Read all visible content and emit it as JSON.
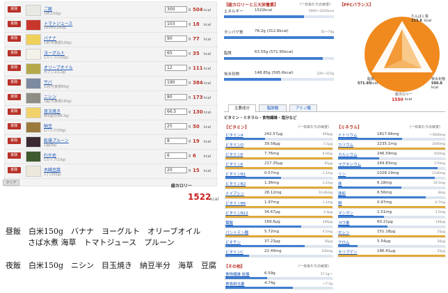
{
  "food_list": {
    "delete_label": "削除",
    "items": [
      {
        "name": "ご飯",
        "sub": "1杯(150g)",
        "qty": "300",
        "unit": "g",
        "kcal": "504",
        "thumb_color": "#e9e9e4"
      },
      {
        "name": "トマトジュース",
        "sub": "180ml(180g)",
        "qty": "103",
        "unit": "g",
        "kcal": "18",
        "thumb_color": "#c9372c"
      },
      {
        "name": "バナナ",
        "sub": "1本(可食部100g)",
        "qty": "90",
        "unit": "g",
        "kcal": "77",
        "thumb_color": "#efd05a"
      },
      {
        "name": "ヨーグルト",
        "sub": "1カップ(100g)",
        "qty": "65",
        "unit": "g",
        "kcal": "35",
        "thumb_color": "#f4f1e8"
      },
      {
        "name": "オリーブオイル",
        "sub": "大さじ1(12g)",
        "qty": "12",
        "unit": "g",
        "kcal": "111",
        "thumb_color": "#b4a94a"
      },
      {
        "name": "サバ",
        "sub": "1切(可食部80g)",
        "qty": "190",
        "unit": "g",
        "kcal": "384",
        "thumb_color": "#7d8aa0"
      },
      {
        "name": "ニシン",
        "sub": "1尾(可食部160g)",
        "qty": "80",
        "unit": "g",
        "kcal": "173",
        "thumb_color": "#8e8e86"
      },
      {
        "name": "目玉焼き",
        "sub": "卵1個分(66.5g)",
        "qty": "66.5",
        "unit": "g",
        "kcal": "130",
        "thumb_color": "#f2d36b"
      },
      {
        "name": "納豆",
        "sub": "1パック(50g)",
        "qty": "25",
        "unit": "g",
        "kcal": "50",
        "thumb_color": "#9c7a3e"
      },
      {
        "name": "乾燥プルーン",
        "sub": "1個(8g)",
        "qty": "8",
        "unit": "g",
        "kcal": "19",
        "thumb_color": "#3b2a33"
      },
      {
        "name": "わかめ",
        "sub": "1カップ(10g)",
        "qty": "6",
        "unit": "g",
        "kcal": "6",
        "thumb_color": "#3e5a2e"
      },
      {
        "name": "木綿豆腐",
        "sub": "1丁(300g)",
        "qty": "20",
        "unit": "g",
        "kcal": "15",
        "thumb_color": "#ece8dc"
      }
    ],
    "kcal_unit": "kcal",
    "clear_label": "クリア",
    "total_label": "総カロリー",
    "total_value": "1522",
    "total_unit": "kcal"
  },
  "memo": {
    "line1": "昼飯　白米150g　バナナ　ヨーグルト　オリーブオイル",
    "line2": "さば水煮 海草　トマトジュース　プルーン",
    "line3": "夜飯　白米150g　ニシン　目玉焼き　納豆半分　海草　豆腐"
  },
  "summary": {
    "title": "【総カロリーと三大栄養素】",
    "target_label": "（一日あたりの目安）",
    "rows": [
      {
        "label": "エネルギー",
        "value": "1522kcal",
        "range": "1900〜2225kcal",
        "fraction": 0.73
      },
      {
        "label": "タンパク質",
        "value": "78.2g (312.8kcal)",
        "range": "45〜70g",
        "fraction": 1.0
      },
      {
        "label": "脂質",
        "value": "63.55g (571.95kcal)",
        "range": "",
        "fraction": 0.9
      },
      {
        "label": "炭水化物",
        "value": "148.85g (595.6kcal)",
        "range": "220〜315g",
        "fraction": 0.52
      }
    ]
  },
  "pfc": {
    "title": "【PFCバランス】",
    "protein_label": "たんぱく質",
    "protein_value": "313.6",
    "protein_unit": "kcal",
    "fat_label": "脂質",
    "fat_value": "571.95",
    "fat_unit": "kcal",
    "carb_label": "炭水化物",
    "carb_value": "590.8",
    "carb_unit": "kcal",
    "total_label": "総カロリー",
    "total_value": "1550",
    "total_unit": "kcal",
    "color": "#f08a1e"
  },
  "tabs": [
    {
      "label": "主要成分",
      "active": true
    },
    {
      "label": "脂肪酸",
      "active": false
    },
    {
      "label": "アミノ酸",
      "active": false
    }
  ],
  "vitmin_heading": "ビタミン・ミネラル・食物繊維・塩分など",
  "vitamins": {
    "title": "【ビタミン】",
    "target_label": "（一日あたりの目安）",
    "rows": [
      {
        "label": "ビタミンA",
        "value": "242.57μg",
        "range": "650μg",
        "fraction": 0.37
      },
      {
        "label": "ビタミンD",
        "value": "39.58μg",
        "range": "5.5μg",
        "fraction": 1.0
      },
      {
        "label": "ビタミンE",
        "value": "7.76mg",
        "range": "6.0mg",
        "fraction": 1.0
      },
      {
        "label": "ビタミンK",
        "value": "217.35μg",
        "range": "65μg",
        "fraction": 1.0
      },
      {
        "label": "ビタミンB1",
        "value": "0.57mg",
        "range": "1.1mg",
        "fraction": 0.52
      },
      {
        "label": "ビタミンB2",
        "value": "1.36mg",
        "range": "1.2mg",
        "fraction": 1.0
      },
      {
        "label": "ナイアシン",
        "value": "28.12mg",
        "range": "10.46mg",
        "fraction": 1.0
      },
      {
        "label": "ビタミンB6",
        "value": "1.97mg",
        "range": "1.1mg",
        "fraction": 1.0
      },
      {
        "label": "ビタミンB12",
        "value": "34.67μg",
        "range": "2.4μg",
        "fraction": 1.0
      },
      {
        "label": "葉酸",
        "value": "169.6μg",
        "range": "240μg",
        "fraction": 0.71
      },
      {
        "label": "パントテン酸",
        "value": "5.72mg",
        "range": "4.5mg",
        "fraction": 1.0
      },
      {
        "label": "ビオチン",
        "value": "37.23μg",
        "range": "50μg",
        "fraction": 0.74
      },
      {
        "label": "ビタミンC",
        "value": "22.49mg",
        "range": "100mg",
        "fraction": 0.22
      }
    ]
  },
  "minerals": {
    "title": "【ミネラル】",
    "target_label": "（一日あたりの目安）",
    "rows": [
      {
        "label": "ナトリウム",
        "value": "1817.66mg",
        "range": "〜3000mg",
        "fraction": 0.6
      },
      {
        "label": "カリウム",
        "value": "2235.1mg",
        "range": "2000mg",
        "fraction": 1.0
      },
      {
        "label": "カルシウム",
        "value": "246.59mg",
        "range": "650mg",
        "fraction": 0.38
      },
      {
        "label": "マグネシウム",
        "value": "249.83mg",
        "range": "270mg",
        "fraction": 0.93
      },
      {
        "label": "リン",
        "value": "1028.19mg",
        "range": "1140mg",
        "fraction": 0.9
      },
      {
        "label": "鉄",
        "value": "6.18mg",
        "range": "10.5mg",
        "fraction": 0.59
      },
      {
        "label": "亜鉛",
        "value": "6.56mg",
        "range": "8mg",
        "fraction": 0.82
      },
      {
        "label": "銅",
        "value": "0.97mg",
        "range": "0.7mg",
        "fraction": 1.0
      },
      {
        "label": "マンガン",
        "value": "1.51mg",
        "range": "3.5mg",
        "fraction": 0.43
      },
      {
        "label": "ヨウ素",
        "value": "60.21μg",
        "range": "130μg",
        "fraction": 0.46
      },
      {
        "label": "セレン",
        "value": "151.18μg",
        "range": "25μg",
        "fraction": 1.0
      },
      {
        "label": "クロム",
        "value": "5.54μg",
        "range": "30μg",
        "fraction": 0.18
      },
      {
        "label": "モリブデン",
        "value": "186.41μg",
        "range": "25μg",
        "fraction": 1.0
      }
    ]
  },
  "others": {
    "title": "【その他】",
    "target_label": "（一日あたりの目安）",
    "rows": [
      {
        "label": "食物繊維 総量",
        "value": "6.59g",
        "range": "17.1g〜",
        "fraction": 0.39
      },
      {
        "label": "食塩相当量",
        "value": "4.74g",
        "range": "〜7.5g",
        "fraction": 0.63
      }
    ]
  }
}
